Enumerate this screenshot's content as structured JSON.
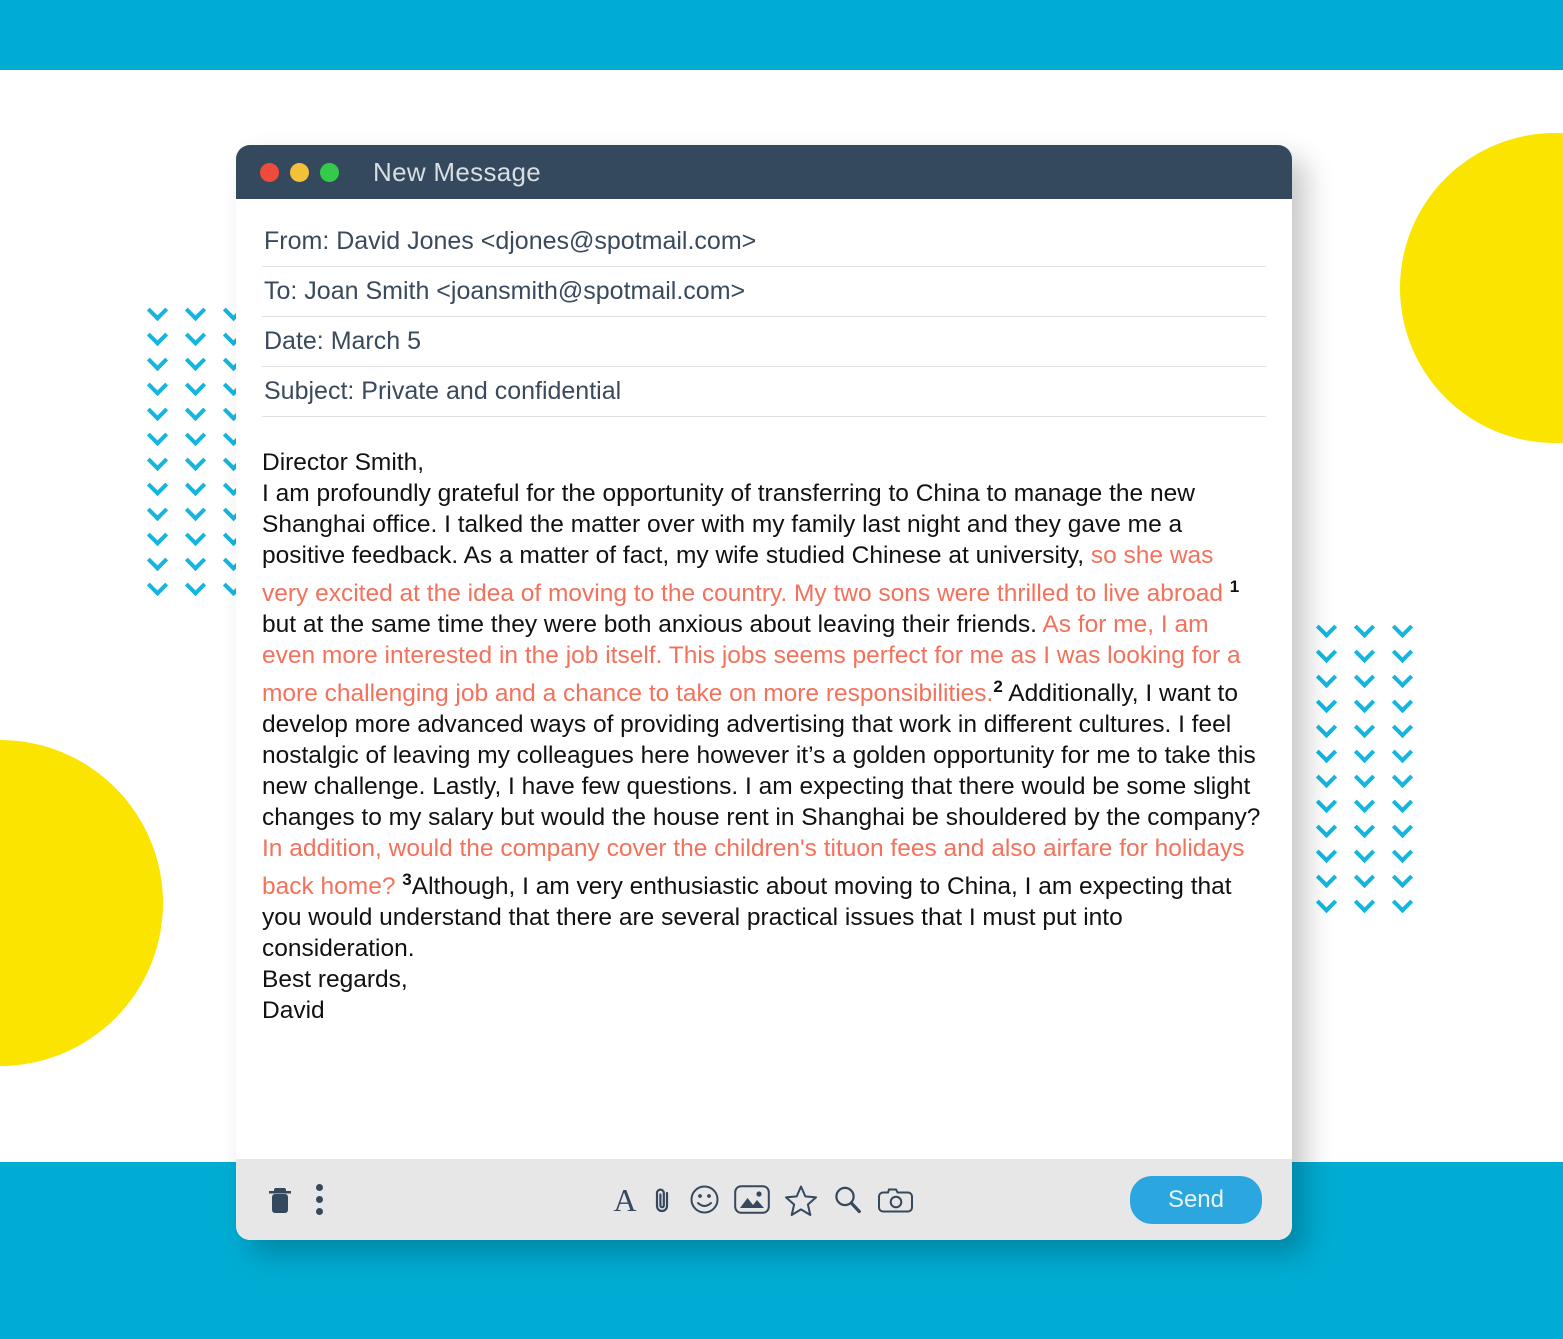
{
  "theme": {
    "accent_cyan": "#00ACD3",
    "accent_yellow": "#FAE400",
    "titlebar_dark": "#35495E",
    "highlight_orange": "#F4715B",
    "send_blue": "#2CA6DE",
    "chevron_blue": "#15B5DF"
  },
  "window": {
    "title": "New  Message",
    "traffic_lights": [
      "close",
      "minimize",
      "maximize"
    ]
  },
  "fields": [
    {
      "name": "from",
      "text": "From: David Jones <djones@spotmail.com>"
    },
    {
      "name": "to",
      "text": "To: Joan Smith <joansmith@spotmail.com>"
    },
    {
      "name": "date",
      "text": "Date: March 5"
    },
    {
      "name": "subject",
      "text": "Subject: Private and confidential"
    }
  ],
  "body": {
    "salutation": "Director Smith,",
    "segments": [
      {
        "style": "plain",
        "text": "I am profoundly grateful for the opportunity of transferring to China to manage the new Shanghai office. I talked the matter over with my family last night and they gave me a positive feedback. As a matter of fact, my wife studied Chinese at university, "
      },
      {
        "style": "highlight",
        "text": "so she was very excited at the idea of moving to the country. My two sons were thrilled to live abroad "
      },
      {
        "style": "footnote",
        "text": "1"
      },
      {
        "style": "plain",
        "text": " but at the same time they were both anxious about leaving their friends. "
      },
      {
        "style": "highlight",
        "text": "As for me, I am even more interested in the job itself. This jobs seems perfect for me as I was looking for a more challenging job and a chance to take on more responsibilities."
      },
      {
        "style": "footnote",
        "text": "2"
      },
      {
        "style": "plain",
        "text": " Additionally, I want to develop more advanced ways of providing advertising that work in different cultures. I feel nostalgic of leaving my colleagues here however it’s a golden opportunity for me to take this new challenge. Lastly, I have few questions. I am expecting that there would be some slight changes to my salary but would the house rent in Shanghai be shouldered by the company? "
      },
      {
        "style": "highlight",
        "text": "In addition, would the company cover the children's tituon fees and also airfare for holidays back home? "
      },
      {
        "style": "footnote",
        "text": "3"
      },
      {
        "style": "plain",
        "text": "Although, I am very enthusiastic about moving to China, I am expecting that you would understand that there are several practical issues that I must put into consideration."
      }
    ],
    "signoff": "Best regards,",
    "signature": "David"
  },
  "footer": {
    "left_icons": [
      {
        "name": "trash-icon",
        "label": "Delete"
      },
      {
        "name": "more-options-icon",
        "label": "More options"
      }
    ],
    "center_icons": [
      {
        "name": "font-icon",
        "label": "Formatting",
        "glyph": "A"
      },
      {
        "name": "attachment-icon",
        "label": "Attach file"
      },
      {
        "name": "emoji-icon",
        "label": "Insert emoji"
      },
      {
        "name": "image-icon",
        "label": "Insert image"
      },
      {
        "name": "star-icon",
        "label": "Mark important"
      },
      {
        "name": "search-icon",
        "label": "Search"
      },
      {
        "name": "camera-icon",
        "label": "Take photo"
      }
    ],
    "send_label": "Send"
  },
  "decor": {
    "chevron_glyph": "chevron-down-icon",
    "chevron_rows": 12,
    "chevron_cols": 3,
    "circles": [
      "yellow-circle-right",
      "yellow-circle-left"
    ]
  }
}
